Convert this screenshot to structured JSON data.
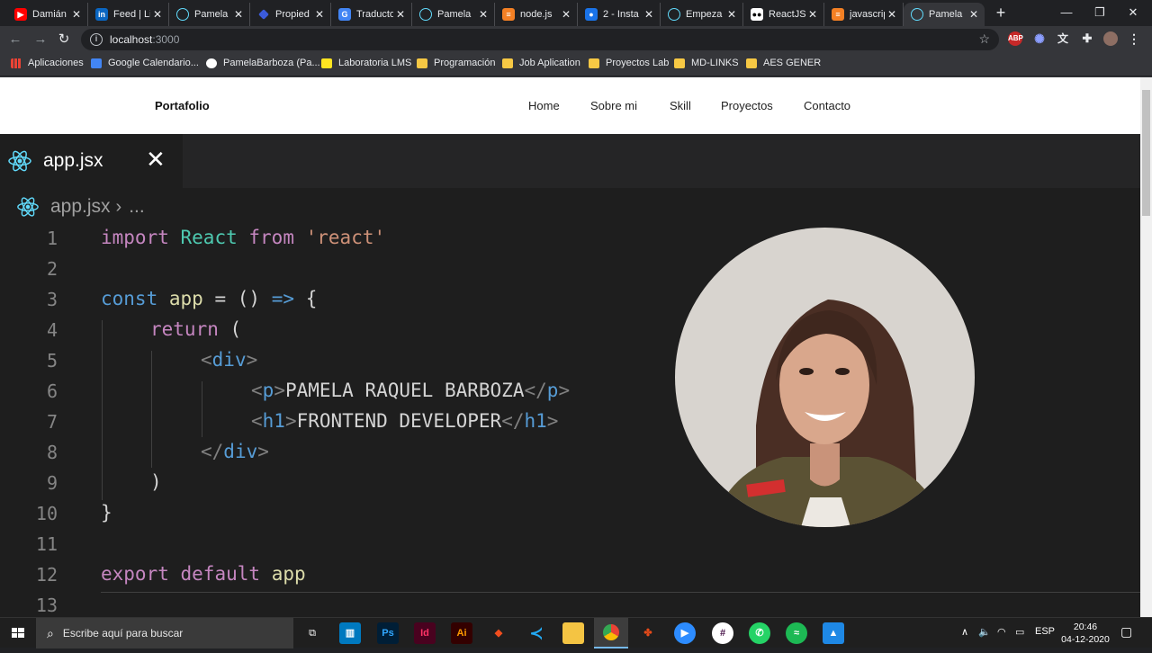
{
  "browser": {
    "tabs": [
      {
        "label": "Damián",
        "icon": "youtube-icon",
        "color": "#ff0000"
      },
      {
        "label": "Feed | Li",
        "icon": "linkedin-icon",
        "color": "#0a66c2"
      },
      {
        "label": "Pamela",
        "icon": "react-icon",
        "color": "#61dafb"
      },
      {
        "label": "Propied",
        "icon": "diamond-icon",
        "color": "#3b5bdb"
      },
      {
        "label": "Traducto",
        "icon": "translate-icon",
        "color": "#4285f4"
      },
      {
        "label": "Pamela",
        "icon": "react-icon",
        "color": "#61dafb"
      },
      {
        "label": "node.js",
        "icon": "stackoverflow-icon",
        "color": "#f48024"
      },
      {
        "label": "2 - Insta",
        "icon": "person-icon",
        "color": "#1a73e8"
      },
      {
        "label": "Empeza",
        "icon": "react-icon",
        "color": "#61dafb"
      },
      {
        "label": "ReactJS",
        "icon": "medium-icon",
        "color": "#ffffff"
      },
      {
        "label": "javascrip",
        "icon": "stackoverflow-icon",
        "color": "#f48024"
      },
      {
        "label": "Pamela",
        "icon": "react-icon",
        "color": "#61dafb"
      }
    ],
    "url_host": "localhost",
    "url_port": ":3000",
    "bookmarks": [
      {
        "label": "Aplicaciones",
        "icon": "apps-grid-icon"
      },
      {
        "label": "Google Calendario...",
        "icon": "calendar-icon"
      },
      {
        "label": "PamelaBarboza (Pa...",
        "icon": "github-icon"
      },
      {
        "label": "Laboratoria LMS",
        "icon": "laboratoria-icon"
      },
      {
        "label": "Programación",
        "icon": "folder-icon"
      },
      {
        "label": "Job Aplication",
        "icon": "folder-icon"
      },
      {
        "label": "Proyectos Lab",
        "icon": "folder-icon"
      },
      {
        "label": "MD-LINKS",
        "icon": "folder-icon"
      },
      {
        "label": "AES GENER",
        "icon": "folder-icon"
      }
    ],
    "extensions": [
      "ABP",
      "gear",
      "translate",
      "puzzle",
      "avatar"
    ]
  },
  "site": {
    "brand": "Portafolio",
    "nav": [
      "Home",
      "Sobre mi",
      "Skill",
      "Proyectos",
      "Contacto"
    ]
  },
  "editor": {
    "filename": "app.jsx",
    "breadcrumb_tail": "...",
    "line_numbers": [
      "1",
      "2",
      "3",
      "4",
      "5",
      "6",
      "7",
      "8",
      "9",
      "10",
      "11",
      "12",
      "13"
    ],
    "code": {
      "l1": {
        "kw": "import",
        "cls": "React",
        "from": "from",
        "str": "'react'"
      },
      "l3": {
        "const": "const",
        "name": "app",
        "eq": "=",
        "parens": "()",
        "arrow": "=>",
        "brace": "{"
      },
      "l4": {
        "ret": "return",
        "paren": "("
      },
      "l5": {
        "open": "<",
        "tag": "div",
        "close": ">"
      },
      "l6": {
        "tag": "p",
        "text": "PAMELA RAQUEL BARBOZA"
      },
      "l7": {
        "tag": "h1",
        "text": "FRONTEND DEVELOPER"
      },
      "l8": {
        "tag": "div"
      },
      "l9": {
        "paren": ")"
      },
      "l10": {
        "brace": "}"
      },
      "l12": {
        "export": "export",
        "default": "default",
        "name": "app"
      }
    }
  },
  "taskbar": {
    "search_placeholder": "Escribe aquí para buscar",
    "apps": [
      "task-view",
      "trello",
      "photoshop",
      "indesign",
      "illustrator",
      "figma",
      "vscode",
      "file-explorer",
      "chrome",
      "git-kraken",
      "zoom",
      "slack",
      "whatsapp",
      "spotify",
      "photos"
    ],
    "language": "ESP",
    "time": "20:46",
    "date": "04-12-2020"
  }
}
